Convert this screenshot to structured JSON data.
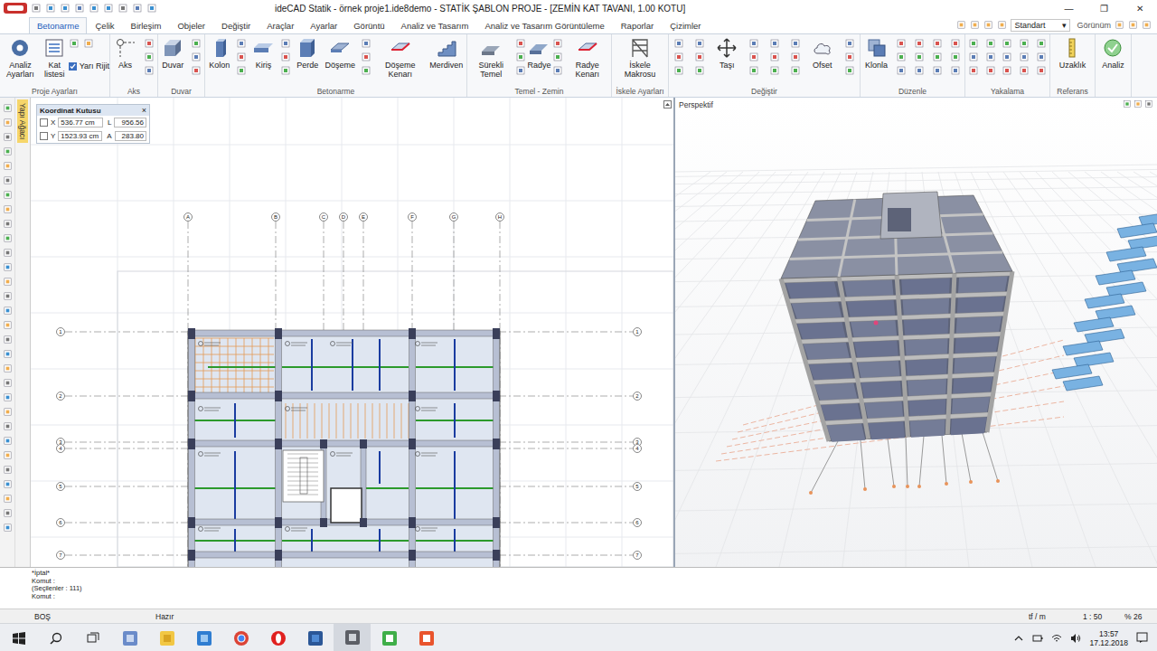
{
  "window": {
    "title": "ideCAD Statik - örnek proje1.ide8demo - STATİK ŞABLON PROJE - [ZEMİN KAT TAVANI, 1.00 KOTU]",
    "minimize": "—",
    "maximize": "❐",
    "close": "✕"
  },
  "tabs": [
    {
      "label": "Betonarme",
      "selected": true
    },
    {
      "label": "Çelik",
      "selected": false
    },
    {
      "label": "Birleşim",
      "selected": false
    },
    {
      "label": "Objeler",
      "selected": false
    },
    {
      "label": "Değiştir",
      "selected": false
    },
    {
      "label": "Araçlar",
      "selected": false
    },
    {
      "label": "Ayarlar",
      "selected": false
    },
    {
      "label": "Görüntü",
      "selected": false
    },
    {
      "label": "Analiz ve Tasarım",
      "selected": false
    },
    {
      "label": "Analiz ve Tasarım Görüntüleme",
      "selected": false
    },
    {
      "label": "Raporlar",
      "selected": false
    },
    {
      "label": "Çizimler",
      "selected": false
    }
  ],
  "toolbar_right": {
    "style": "Standart",
    "arrow": "▾",
    "view": "Görünüm"
  },
  "ribbon": [
    {
      "label": "Proje Ayarları",
      "buttons": [
        "Analiz Ayarları",
        "Kat listesi"
      ]
    },
    {
      "label": "Aks",
      "buttons": [
        "Aks"
      ]
    },
    {
      "label": "Duvar",
      "buttons": [
        "Duvar"
      ]
    },
    {
      "label": "Betonarme",
      "buttons": [
        "Kolon",
        "Kiriş",
        "Perde",
        "Döşeme",
        "Döşeme Kenarı",
        "Merdiven"
      ]
    },
    {
      "label": "Temel - Zemin",
      "buttons": [
        "Sürekli Temel",
        "Radye",
        "Radye Kenarı"
      ]
    },
    {
      "label": "İskele Ayarları",
      "buttons": [
        "İskele Makrosu"
      ]
    },
    {
      "label": "Değiştir",
      "buttons": [
        "Taşı",
        "Ofset"
      ]
    },
    {
      "label": "Düzenle",
      "buttons": [
        "Klonla"
      ]
    },
    {
      "label": "Yakalama",
      "buttons": []
    },
    {
      "label": "Referans",
      "buttons": [
        "Uzaklık"
      ]
    },
    {
      "label": "",
      "buttons": [
        "Analiz"
      ]
    }
  ],
  "semi_rigid": {
    "label": "Yarı Rijit",
    "checked": true
  },
  "side_tab": "Yapı Ağacı",
  "coord_box": {
    "title": "Koordinat Kutusu",
    "close": "×",
    "rows": [
      {
        "label": "X",
        "locked": false,
        "value": "536.77 cm",
        "label2": "L",
        "value2": "956.56"
      },
      {
        "label": "Y",
        "locked": false,
        "value": "1523.93 cm",
        "label2": "A",
        "value2": "283.80"
      }
    ]
  },
  "plan": {
    "top_axes": [
      "A",
      "B",
      "C",
      "D",
      "E",
      "F",
      "G",
      "H"
    ],
    "left_axes": [
      "1",
      "2",
      "3",
      "4",
      "5",
      "6",
      "7"
    ]
  },
  "perspective": {
    "label": "Perspektif"
  },
  "command": [
    "*İptal*",
    "Komut :",
    "(Seçilenler : 111)",
    "Komut :"
  ],
  "status": {
    "mode": "BOŞ",
    "state": "Hazır",
    "unit": "tf / m",
    "scale": "1 : 50",
    "zoom": "% 26"
  },
  "taskbar": {
    "apps": [
      {
        "selected": false
      },
      {
        "selected": false
      },
      {
        "selected": false
      },
      {
        "selected": false
      },
      {
        "selected": false
      },
      {
        "selected": false
      },
      {
        "selected": true
      },
      {
        "selected": false
      },
      {
        "selected": false
      }
    ],
    "time": "13:57",
    "date": "17.12.2018"
  }
}
